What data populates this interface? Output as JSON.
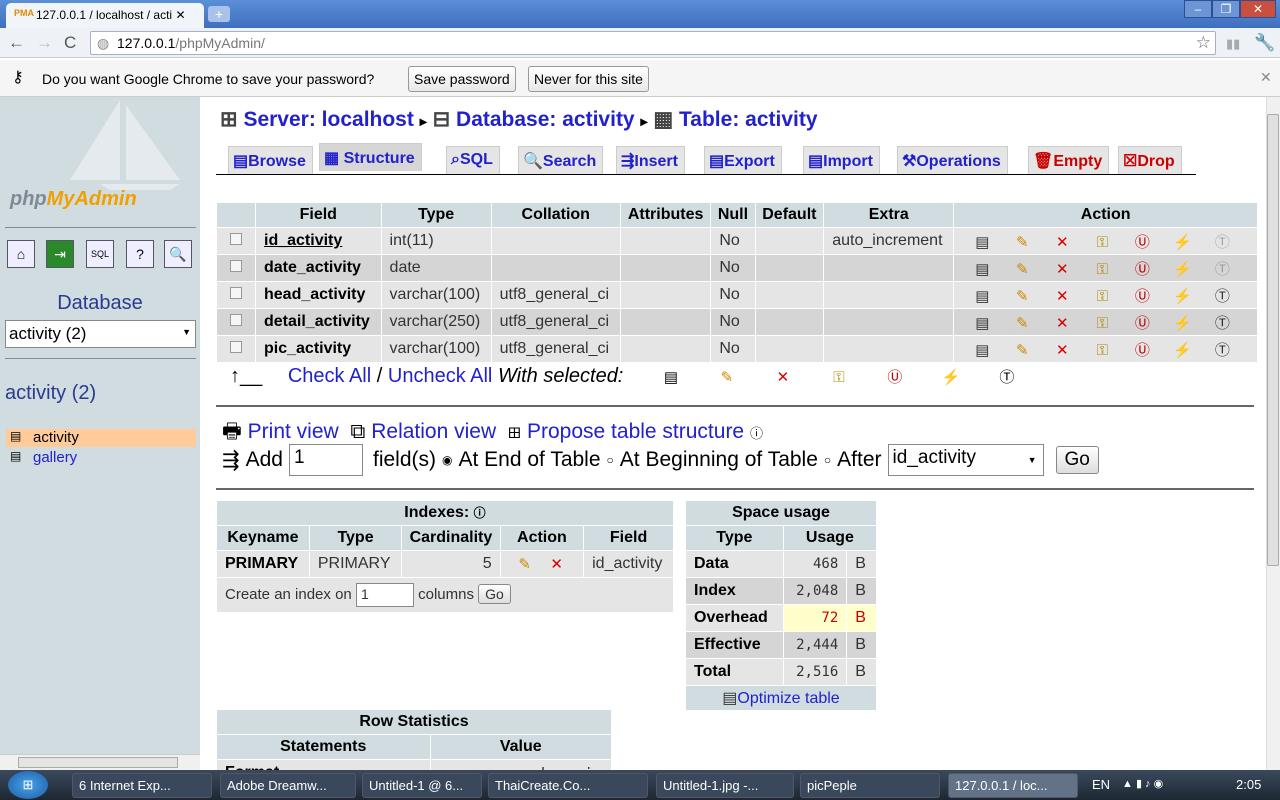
{
  "browser": {
    "tab_title": "127.0.0.1 / localhost / acti",
    "tab_favicon": "PMA",
    "url_host": "127.0.0.1",
    "url_path": "/phpMyAdmin/",
    "infobar": {
      "message": "Do you want Google Chrome to save your password?",
      "save": "Save password",
      "never": "Never for this site"
    }
  },
  "sidebar": {
    "logo_php": "php",
    "logo_my": "MyAdmin",
    "db_label": "Database",
    "db_select": "activity (2)",
    "db_heading": "activity (2)",
    "tables": [
      "activity",
      "gallery"
    ]
  },
  "breadcrumb": {
    "server": "Server: localhost",
    "database": "Database: activity",
    "table": "Table: activity"
  },
  "tabs": [
    "Browse",
    "Structure",
    "SQL",
    "Search",
    "Insert",
    "Export",
    "Import",
    "Operations",
    "Empty",
    "Drop"
  ],
  "structure": {
    "headers": [
      "Field",
      "Type",
      "Collation",
      "Attributes",
      "Null",
      "Default",
      "Extra",
      "Action"
    ],
    "rows": [
      {
        "field": "id_activity",
        "type": "int(11)",
        "collation": "",
        "attributes": "",
        "null": "No",
        "default": "",
        "extra": "auto_increment"
      },
      {
        "field": "date_activity",
        "type": "date",
        "collation": "",
        "attributes": "",
        "null": "No",
        "default": "",
        "extra": ""
      },
      {
        "field": "head_activity",
        "type": "varchar(100)",
        "collation": "utf8_general_ci",
        "attributes": "",
        "null": "No",
        "default": "",
        "extra": ""
      },
      {
        "field": "detail_activity",
        "type": "varchar(250)",
        "collation": "utf8_general_ci",
        "attributes": "",
        "null": "No",
        "default": "",
        "extra": ""
      },
      {
        "field": "pic_activity",
        "type": "varchar(100)",
        "collation": "utf8_general_ci",
        "attributes": "",
        "null": "No",
        "default": "",
        "extra": ""
      }
    ],
    "check_all": "Check All",
    "sep": "/",
    "uncheck_all": "Uncheck All",
    "with_selected": "With selected:"
  },
  "links": {
    "print": "Print view",
    "relation": "Relation view",
    "propose": "Propose table structure"
  },
  "add": {
    "label": "Add",
    "count": "1",
    "fields": "field(s)",
    "at_end": "At End of Table",
    "at_begin": "At Beginning of Table",
    "after": "After",
    "after_field": "id_activity",
    "go": "Go"
  },
  "indexes": {
    "title": "Indexes:",
    "headers": [
      "Keyname",
      "Type",
      "Cardinality",
      "Action",
      "Field"
    ],
    "row": {
      "keyname": "PRIMARY",
      "type": "PRIMARY",
      "cardinality": "5",
      "field": "id_activity"
    },
    "create_label": "Create an index on",
    "create_count": "1",
    "columns": "columns",
    "go": "Go"
  },
  "space": {
    "title": "Space usage",
    "headers": [
      "Type",
      "Usage"
    ],
    "rows": [
      {
        "type": "Data",
        "value": "468",
        "unit": "B"
      },
      {
        "type": "Index",
        "value": "2,048",
        "unit": "B"
      },
      {
        "type": "Overhead",
        "value": "72",
        "unit": "B"
      },
      {
        "type": "Effective",
        "value": "2,444",
        "unit": "B"
      },
      {
        "type": "Total",
        "value": "2,516",
        "unit": "B"
      }
    ],
    "optimize": "Optimize table"
  },
  "rowstats": {
    "title": "Row Statistics",
    "headers": [
      "Statements",
      "Value"
    ],
    "row": {
      "name": "Format",
      "value": "dynamic"
    }
  },
  "taskbar": {
    "items": [
      "6 Internet Exp...",
      "Adobe Dreamw...",
      "Untitled-1 @ 6...",
      "ThaiCreate.Co...",
      "Untitled-1.jpg -...",
      "picPeple",
      "127.0.0.1 / loc..."
    ],
    "lang": "EN",
    "time": "2:05"
  }
}
